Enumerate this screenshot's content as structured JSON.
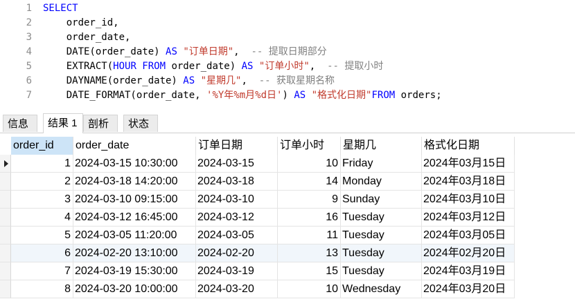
{
  "editor": {
    "lines": [
      {
        "num": "1",
        "segs": [
          {
            "t": "SELECT",
            "c": "kw"
          }
        ]
      },
      {
        "num": "2",
        "segs": [
          {
            "t": "    order_id,",
            "c": "fn"
          }
        ]
      },
      {
        "num": "3",
        "segs": [
          {
            "t": "    order_date,",
            "c": "fn"
          }
        ]
      },
      {
        "num": "4",
        "segs": [
          {
            "t": "    DATE(order_date) ",
            "c": "fn"
          },
          {
            "t": "AS ",
            "c": "kw"
          },
          {
            "t": "\"订单日期\"",
            "c": "str"
          },
          {
            "t": ",  ",
            "c": "fn"
          },
          {
            "t": "-- 提取日期部分",
            "c": "cm"
          }
        ]
      },
      {
        "num": "5",
        "segs": [
          {
            "t": "    EXTRACT(",
            "c": "fn"
          },
          {
            "t": "HOUR FROM ",
            "c": "kw"
          },
          {
            "t": "order_date) ",
            "c": "fn"
          },
          {
            "t": "AS ",
            "c": "kw"
          },
          {
            "t": "\"订单小时\"",
            "c": "str"
          },
          {
            "t": ",  ",
            "c": "fn"
          },
          {
            "t": "-- 提取小时",
            "c": "cm"
          }
        ]
      },
      {
        "num": "6",
        "segs": [
          {
            "t": "    DAYNAME(order_date) ",
            "c": "fn"
          },
          {
            "t": "AS ",
            "c": "kw"
          },
          {
            "t": "\"星期几\"",
            "c": "str"
          },
          {
            "t": ",  ",
            "c": "fn"
          },
          {
            "t": "-- 获取星期名称",
            "c": "cm"
          }
        ]
      },
      {
        "num": "7",
        "segs": [
          {
            "t": "    DATE_FORMAT(order_date, ",
            "c": "fn"
          },
          {
            "t": "'%Y年%m月%d日'",
            "c": "str"
          },
          {
            "t": ") ",
            "c": "fn"
          },
          {
            "t": "AS ",
            "c": "kw"
          },
          {
            "t": "\"格式化日期\"",
            "c": "str"
          },
          {
            "t": "FROM ",
            "c": "kw"
          },
          {
            "t": "orders;",
            "c": "fn"
          }
        ]
      }
    ]
  },
  "tabs": [
    {
      "label": "信息",
      "active": false
    },
    {
      "label": "结果 1",
      "active": true
    },
    {
      "label": "剖析",
      "active": false
    },
    {
      "label": "状态",
      "active": false
    }
  ],
  "grid": {
    "columns": [
      "order_id",
      "order_date",
      "订单日期",
      "订单小时",
      "星期几",
      "格式化日期"
    ],
    "rows": [
      [
        "1",
        "2024-03-15 10:30:00",
        "2024-03-15",
        "10",
        "Friday",
        "2024年03月15日"
      ],
      [
        "2",
        "2024-03-18 14:20:00",
        "2024-03-18",
        "14",
        "Monday",
        "2024年03月18日"
      ],
      [
        "3",
        "2024-03-10 09:15:00",
        "2024-03-10",
        "9",
        "Sunday",
        "2024年03月10日"
      ],
      [
        "4",
        "2024-03-12 16:45:00",
        "2024-03-12",
        "16",
        "Tuesday",
        "2024年03月12日"
      ],
      [
        "5",
        "2024-03-05 11:20:00",
        "2024-03-05",
        "11",
        "Tuesday",
        "2024年03月05日"
      ],
      [
        "6",
        "2024-02-20 13:10:00",
        "2024-02-20",
        "13",
        "Tuesday",
        "2024年02月20日"
      ],
      [
        "7",
        "2024-03-19 15:30:00",
        "2024-03-19",
        "15",
        "Tuesday",
        "2024年03月19日"
      ],
      [
        "8",
        "2024-03-20 10:00:00",
        "2024-03-20",
        "10",
        "Wednesday",
        "2024年03月20日"
      ]
    ]
  }
}
